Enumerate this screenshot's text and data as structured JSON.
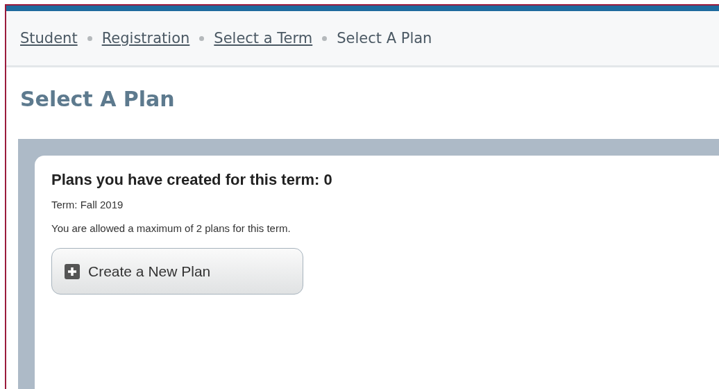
{
  "breadcrumb": [
    {
      "label": "Student",
      "link": true
    },
    {
      "label": "Registration",
      "link": true
    },
    {
      "label": "Select a Term",
      "link": true
    },
    {
      "label": "Select A Plan",
      "link": false
    }
  ],
  "page_title": "Select A Plan",
  "card": {
    "heading": "Plans you have created for this term: 0",
    "term": "Term: Fall 2019",
    "note": "You are allowed a maximum of 2 plans for this term.",
    "button": "Create a New Plan"
  }
}
